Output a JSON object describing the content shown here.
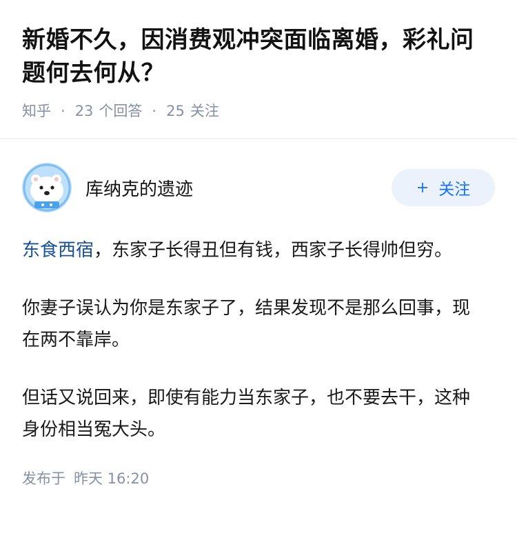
{
  "question": {
    "title": "新婚不久，因消费观冲突面临离婚，彩礼问题何去何从？",
    "source": "知乎",
    "answer_count": "23",
    "answer_label": "个回答",
    "follow_count": "25",
    "follow_label": "关注"
  },
  "answer": {
    "author_name": "库纳克的遗迹",
    "follow_button_label": "关注",
    "paragraph1_link": "东食西宿",
    "paragraph1_rest": "，东家子长得丑但有钱，西家子长得帅但穷。",
    "paragraph2": "你妻子误认为你是东家子了，结果发现不是那么回事，现在两不靠岸。",
    "paragraph3": "但话又说回来，即使有能力当东家子，也不要去干，这种身份相当冤大头。",
    "published_label": "发布于",
    "published_time": "昨天 16:20"
  },
  "colors": {
    "link": "#175199",
    "accent": "#1772f6",
    "meta_gray": "#8590a6",
    "follow_bg": "#ebf2fb"
  },
  "icons": {
    "avatar": "cartoon-bear-astronaut-avatar",
    "plus": "plus-icon"
  }
}
